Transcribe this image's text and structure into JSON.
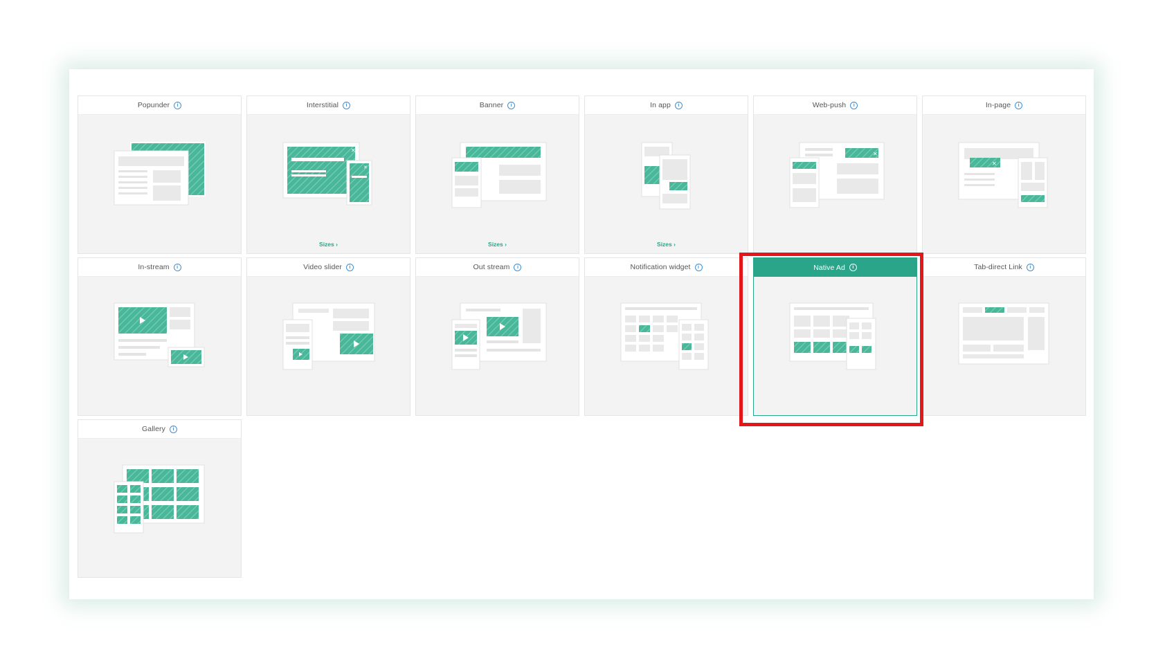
{
  "cards": [
    {
      "title": "Popunder",
      "sizes": null,
      "selected": false
    },
    {
      "title": "Interstitial",
      "sizes": "Sizes ›",
      "selected": false
    },
    {
      "title": "Banner",
      "sizes": "Sizes ›",
      "selected": false
    },
    {
      "title": "In app",
      "sizes": "Sizes ›",
      "selected": false
    },
    {
      "title": "Web-push",
      "sizes": null,
      "selected": false
    },
    {
      "title": "In-page",
      "sizes": null,
      "selected": false
    },
    {
      "title": "In-stream",
      "sizes": null,
      "selected": false
    },
    {
      "title": "Video slider",
      "sizes": null,
      "selected": false
    },
    {
      "title": "Out stream",
      "sizes": null,
      "selected": false
    },
    {
      "title": "Notification widget",
      "sizes": null,
      "selected": false
    },
    {
      "title": "Native Ad",
      "sizes": null,
      "selected": true
    },
    {
      "title": "Tab-direct Link",
      "sizes": null,
      "selected": false
    },
    {
      "title": "Gallery",
      "sizes": null,
      "selected": false
    }
  ],
  "info_icon": "info-icon",
  "colors": {
    "accent": "#2aa58a",
    "highlight": "#e2171b",
    "info": "#3b8fd6",
    "card_bg": "#f3f3f3"
  }
}
